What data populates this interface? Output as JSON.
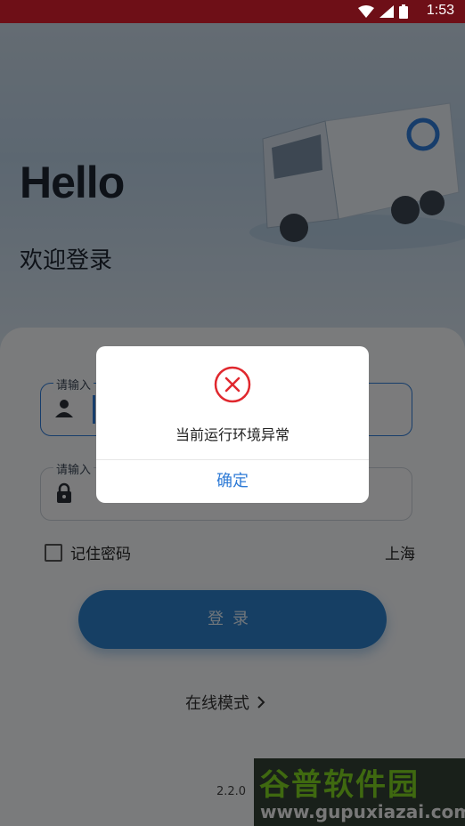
{
  "status_bar": {
    "time": "1:53",
    "icons": [
      "wifi-icon",
      "signal-icon",
      "battery-icon"
    ]
  },
  "hero": {
    "greeting": "Hello",
    "subtitle": "欢迎登录"
  },
  "form": {
    "username": {
      "label": "请输入",
      "icon": "user-icon"
    },
    "password": {
      "label": "请输入",
      "icon": "lock-icon"
    },
    "remember_label": "记住密码",
    "city": "上海",
    "login_label": "登录",
    "online_mode_label": "在线模式",
    "version": "2.2.0"
  },
  "watermark": {
    "title": "谷普软件园",
    "url": "www.gupuxiazai.com"
  },
  "dialog": {
    "message": "当前运行环境异常",
    "confirm_label": "确定",
    "icon": "error-x-icon",
    "accent": "#e0282e"
  },
  "colors": {
    "status_bar": "#6e0f17",
    "primary": "#2f7bd6",
    "login_button": "#2c7ec8"
  }
}
